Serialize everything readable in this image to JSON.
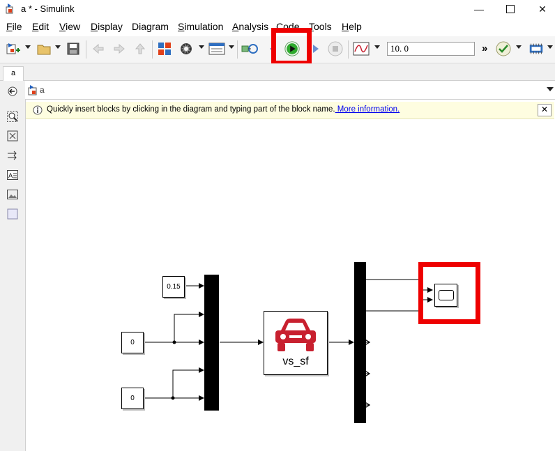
{
  "window": {
    "title": "a * - Simulink"
  },
  "menu": [
    {
      "accel": "F",
      "rest": "ile"
    },
    {
      "accel": "E",
      "rest": "dit"
    },
    {
      "accel": "V",
      "rest": "iew"
    },
    {
      "accel": "D",
      "rest": "isplay"
    },
    {
      "accel": "",
      "rest": "Diagram"
    },
    {
      "accel": "S",
      "rest": "imulation"
    },
    {
      "accel": "A",
      "rest": "nalysis"
    },
    {
      "accel": "C",
      "rest": "ode"
    },
    {
      "accel": "T",
      "rest": "ools"
    },
    {
      "accel": "H",
      "rest": "elp"
    }
  ],
  "toolbar": {
    "stop_time": "10. 0",
    "more": "»"
  },
  "tabs": {
    "active": "a"
  },
  "address": {
    "path": "a"
  },
  "info_bar": {
    "text": "Quickly insert blocks by clicking in the diagram and typing part of the block name.",
    "link": " More information.",
    "close": "✕"
  },
  "diagram": {
    "constant_1": "0.15",
    "constant_2": "0",
    "constant_3": "0",
    "vehicle_block": "vs_sf"
  },
  "colors": {
    "highlight": "#ee0000",
    "car": "#c8202f",
    "run": "#2eaa2e"
  }
}
